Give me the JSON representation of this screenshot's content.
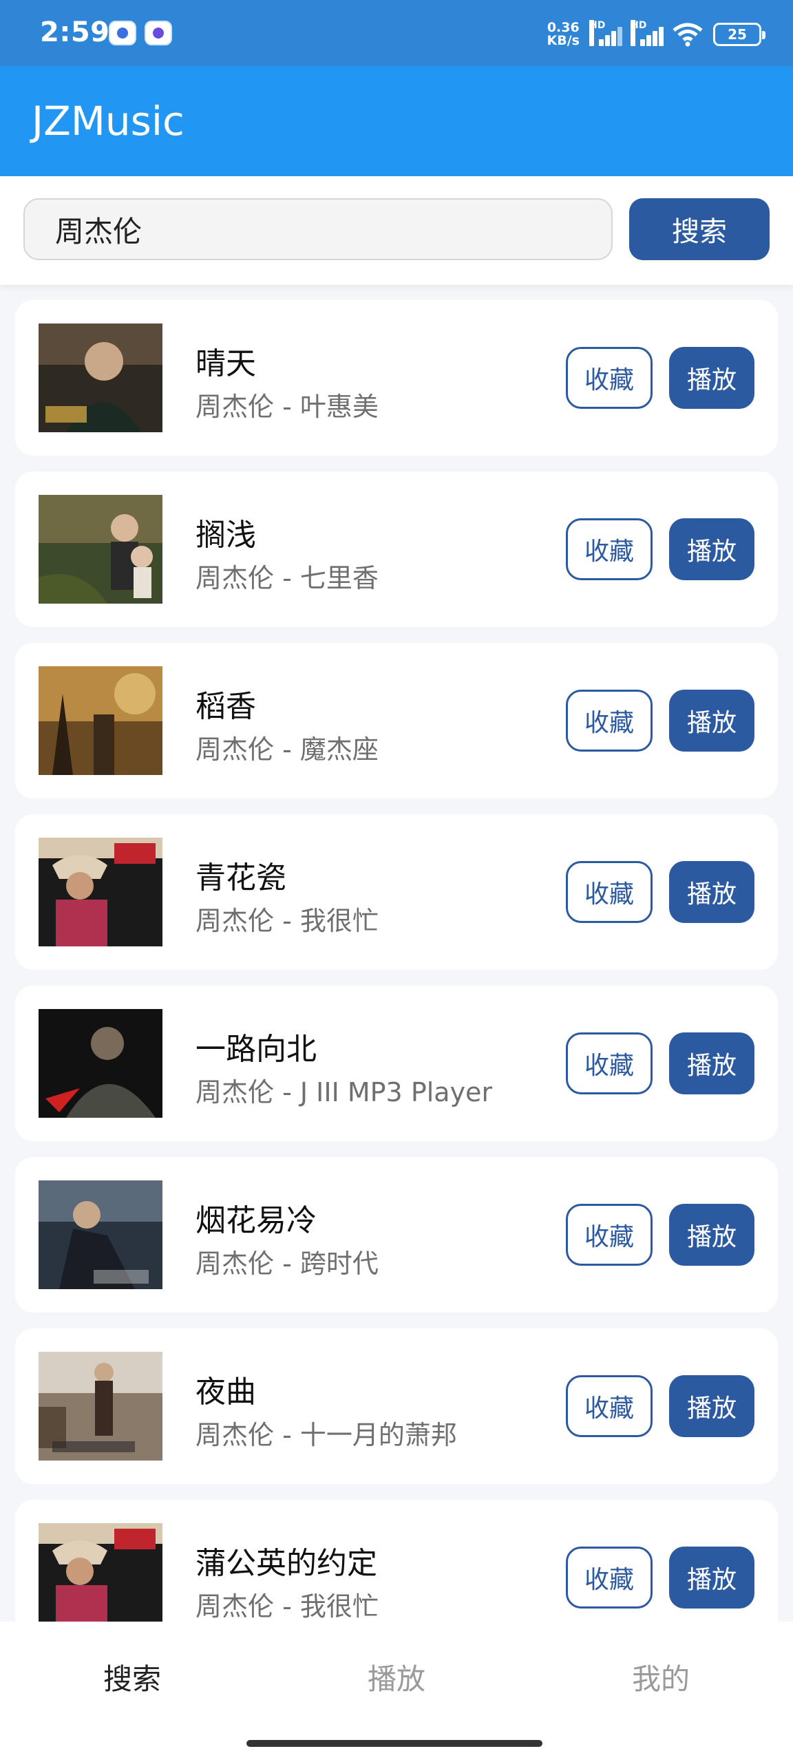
{
  "status_bar": {
    "time": "2:59",
    "net_speed_value": "0.36",
    "net_speed_unit": "KB/s",
    "hd1": "HD",
    "hd2": "HD",
    "battery": "25"
  },
  "app": {
    "title": "JZMusic"
  },
  "search": {
    "query": "周杰伦",
    "button_label": "搜索"
  },
  "songs": [
    {
      "title": "晴天",
      "subtitle": "周杰伦 - 叶惠美",
      "fav_label": "收藏",
      "play_label": "播放"
    },
    {
      "title": "搁浅",
      "subtitle": "周杰伦 - 七里香",
      "fav_label": "收藏",
      "play_label": "播放"
    },
    {
      "title": "稻香",
      "subtitle": "周杰伦 - 魔杰座",
      "fav_label": "收藏",
      "play_label": "播放"
    },
    {
      "title": "青花瓷",
      "subtitle": "周杰伦 - 我很忙",
      "fav_label": "收藏",
      "play_label": "播放"
    },
    {
      "title": "一路向北",
      "subtitle": "周杰伦 - J III MP3 Player",
      "fav_label": "收藏",
      "play_label": "播放"
    },
    {
      "title": "烟花易冷",
      "subtitle": "周杰伦 - 跨时代",
      "fav_label": "收藏",
      "play_label": "播放"
    },
    {
      "title": "夜曲",
      "subtitle": "周杰伦 - 十一月的萧邦",
      "fav_label": "收藏",
      "play_label": "播放"
    },
    {
      "title": "蒲公英的约定",
      "subtitle": "周杰伦 - 我很忙",
      "fav_label": "收藏",
      "play_label": "播放"
    }
  ],
  "bottom_nav": {
    "search": "搜索",
    "play": "播放",
    "mine": "我的"
  },
  "colors": {
    "primary": "#2196f3",
    "button": "#2c5aa0",
    "status_bar": "#2f86d6"
  }
}
